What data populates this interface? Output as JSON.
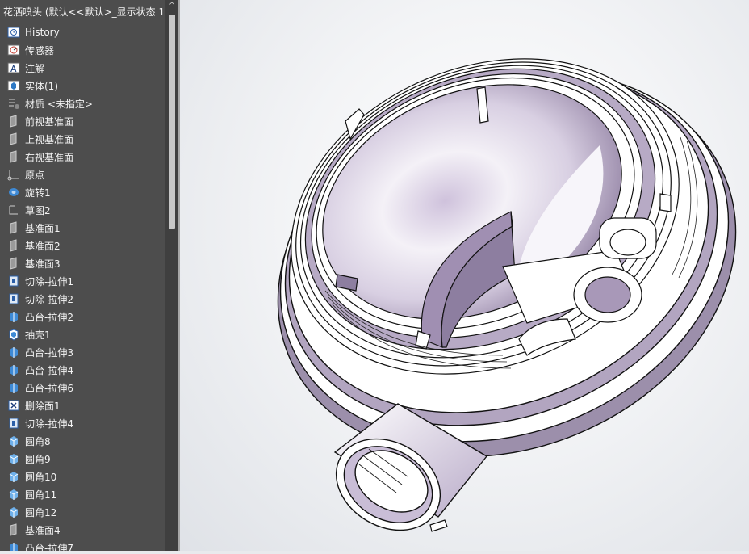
{
  "document": {
    "title": "花洒喷头 (默认<<默认>_显示状态 1"
  },
  "tree_items": [
    {
      "label": "History",
      "icon": "history-icon"
    },
    {
      "label": "传感器",
      "icon": "sensor-icon"
    },
    {
      "label": "注解",
      "icon": "annotation-icon"
    },
    {
      "label": "实体(1)",
      "icon": "solid-bodies-icon"
    },
    {
      "label": "材质 <未指定>",
      "icon": "material-icon"
    },
    {
      "label": "前视基准面",
      "icon": "plane-icon"
    },
    {
      "label": "上视基准面",
      "icon": "plane-icon"
    },
    {
      "label": "右视基准面",
      "icon": "plane-icon"
    },
    {
      "label": "原点",
      "icon": "origin-icon"
    },
    {
      "label": "旋转1",
      "icon": "revolve-icon"
    },
    {
      "label": "草图2",
      "icon": "sketch-icon"
    },
    {
      "label": "基准面1",
      "icon": "plane-icon"
    },
    {
      "label": "基准面2",
      "icon": "plane-icon"
    },
    {
      "label": "基准面3",
      "icon": "plane-icon"
    },
    {
      "label": "切除-拉伸1",
      "icon": "cut-extrude-icon"
    },
    {
      "label": "切除-拉伸2",
      "icon": "cut-extrude-icon"
    },
    {
      "label": "凸台-拉伸2",
      "icon": "boss-extrude-icon"
    },
    {
      "label": "抽壳1",
      "icon": "shell-icon"
    },
    {
      "label": "凸台-拉伸3",
      "icon": "boss-extrude-icon"
    },
    {
      "label": "凸台-拉伸4",
      "icon": "boss-extrude-icon"
    },
    {
      "label": "凸台-拉伸6",
      "icon": "boss-extrude-icon"
    },
    {
      "label": "删除面1",
      "icon": "delete-face-icon"
    },
    {
      "label": "切除-拉伸4",
      "icon": "cut-extrude-icon"
    },
    {
      "label": "圆角8",
      "icon": "fillet-icon"
    },
    {
      "label": "圆角9",
      "icon": "fillet-icon"
    },
    {
      "label": "圆角10",
      "icon": "fillet-icon"
    },
    {
      "label": "圆角11",
      "icon": "fillet-icon"
    },
    {
      "label": "圆角12",
      "icon": "fillet-icon"
    },
    {
      "label": "基准面4",
      "icon": "plane-icon"
    },
    {
      "label": "凸台-拉伸7",
      "icon": "boss-extrude-icon"
    }
  ],
  "scrollbar": {
    "up_arrow": "^"
  },
  "colors": {
    "tree_bg": "#4d4d4d",
    "tree_text": "#f3f3f3",
    "model_fill": "#e6e0ec",
    "model_shade": "#a99bb8",
    "edge": "#111111"
  }
}
